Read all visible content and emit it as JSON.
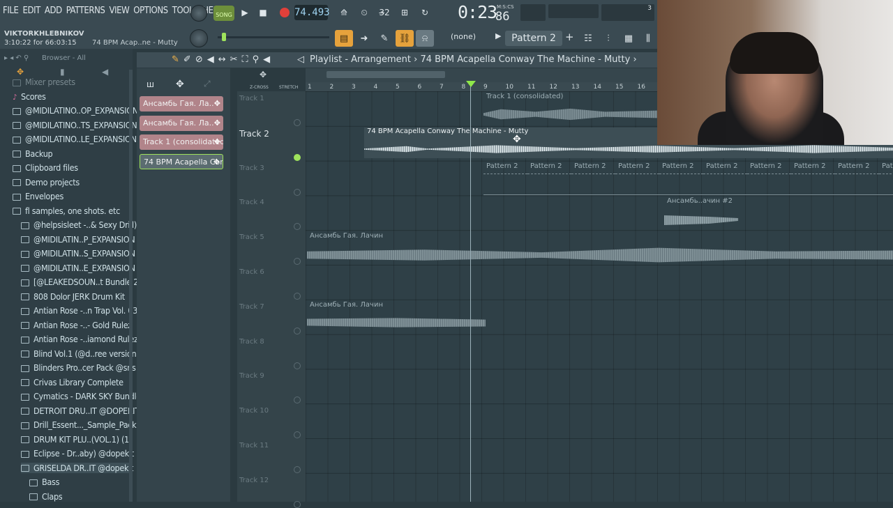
{
  "menu": [
    "FILE",
    "EDIT",
    "ADD",
    "PATTERNS",
    "VIEW",
    "OPTIONS",
    "TOOLS",
    "HELP"
  ],
  "transport": {
    "mode_label": "SONG",
    "tempo": "74.493",
    "time": "0:23",
    "time_ms": "86",
    "time_unit": "M:S:CS",
    "meter_value": "3"
  },
  "user": {
    "name": "VIKTORKHLEBNIKOV",
    "session": "3:10:22 for 66:03:15",
    "hint": "74 BPM Acap..ne - Mutty"
  },
  "toolbar": {
    "pattern_none": "(none)",
    "pattern_name": "Pattern 2"
  },
  "browser": {
    "title": "Browser - All",
    "items": [
      {
        "label": "Mixer presets",
        "indent": 0
      },
      {
        "label": "Scores",
        "indent": 0
      },
      {
        "label": "@MIDILATINO..OP_EXPANSION",
        "indent": 0
      },
      {
        "label": "@MIDILATINO..TS_EXPANSION",
        "indent": 0
      },
      {
        "label": "@MIDILATINO..LE_EXPANSION",
        "indent": 0
      },
      {
        "label": "Backup",
        "indent": 0
      },
      {
        "label": "Clipboard files",
        "indent": 0
      },
      {
        "label": "Demo projects",
        "indent": 0
      },
      {
        "label": "Envelopes",
        "indent": 0
      },
      {
        "label": "fl samples, one shots. etc",
        "indent": 0
      },
      {
        "label": "@helpsisleet -..& Sexy Drill)",
        "indent": 1
      },
      {
        "label": "@MIDILATIN..P_EXPANSION",
        "indent": 1
      },
      {
        "label": "@MIDILATIN..S_EXPANSION",
        "indent": 1
      },
      {
        "label": "@MIDILATIN..E_EXPANSION",
        "indent": 1
      },
      {
        "label": "[@LEAKEDSOUN..t Bundle 2",
        "indent": 1
      },
      {
        "label": "808 Dolor JERK Drum Kit",
        "indent": 1
      },
      {
        "label": "Antian Rose -..n Trap Vol. 03",
        "indent": 1
      },
      {
        "label": "Antian Rose -..- Gold Rulez",
        "indent": 1
      },
      {
        "label": "Antian Rose -..iamond Rulez",
        "indent": 1
      },
      {
        "label": "Blind Vol.1 (@d..ree version)",
        "indent": 1
      },
      {
        "label": "Blinders Pro..cer Pack @sns",
        "indent": 1
      },
      {
        "label": "Crivas Library Complete",
        "indent": 1
      },
      {
        "label": "Cymatics - DARK SKY Bundle",
        "indent": 1
      },
      {
        "label": "DETROIT DRU..IT @DOPEKIT",
        "indent": 1
      },
      {
        "label": "Drill_Essent..._Sample_Pack",
        "indent": 1
      },
      {
        "label": "DRUM KIT PLU..(VOL.1) (1)",
        "indent": 1
      },
      {
        "label": "Eclipse - Dr..aby) @dopekit",
        "indent": 1
      },
      {
        "label": "GRISELDA DR..IT @dopekit",
        "indent": 1
      },
      {
        "label": "Bass",
        "indent": 2
      },
      {
        "label": "Claps",
        "indent": 2
      }
    ]
  },
  "channels": [
    {
      "label": "Ансамбь Гая. Ла..",
      "style": "pink"
    },
    {
      "label": "Ансамбь Гая. Ла..",
      "style": "pink"
    },
    {
      "label": "Track 1 (consolidated)",
      "style": "pink"
    },
    {
      "label": "74 BPM Acapella Con..",
      "style": "green"
    }
  ],
  "playlist": {
    "breadcrumb": "Playlist - Arrangement",
    "clip_name": "74 BPM Acapella Conway The Machine - Mutty",
    "header_labels": {
      "zcross": "Z-CROSS",
      "stretch": "STRETCH"
    },
    "ruler": [
      "1",
      "2",
      "3",
      "4",
      "5",
      "6",
      "7",
      "8",
      "9",
      "10",
      "11",
      "12",
      "13",
      "14",
      "15",
      "16"
    ],
    "tracks": [
      "Track 1",
      "Track 2",
      "Track 3",
      "Track 4",
      "Track 5",
      "Track 6",
      "Track 7",
      "Track 8",
      "Track 9",
      "Track 10",
      "Track 11",
      "Track 12"
    ],
    "clips": {
      "track1": "Track 1 (consolidated)",
      "track2": "74 BPM Acapella Conway The Machine - Mutty",
      "track3_pattern": "Pattern 2",
      "track4": "Ансамбь..ачин #2",
      "track5": "Ансамбь Гая. Лачин",
      "track7": "Ансамбь Гая. Лачин"
    }
  },
  "colors": {
    "accent_green": "#8fe84a",
    "record": "#e0403a",
    "link_orange": "#e6a23c"
  }
}
